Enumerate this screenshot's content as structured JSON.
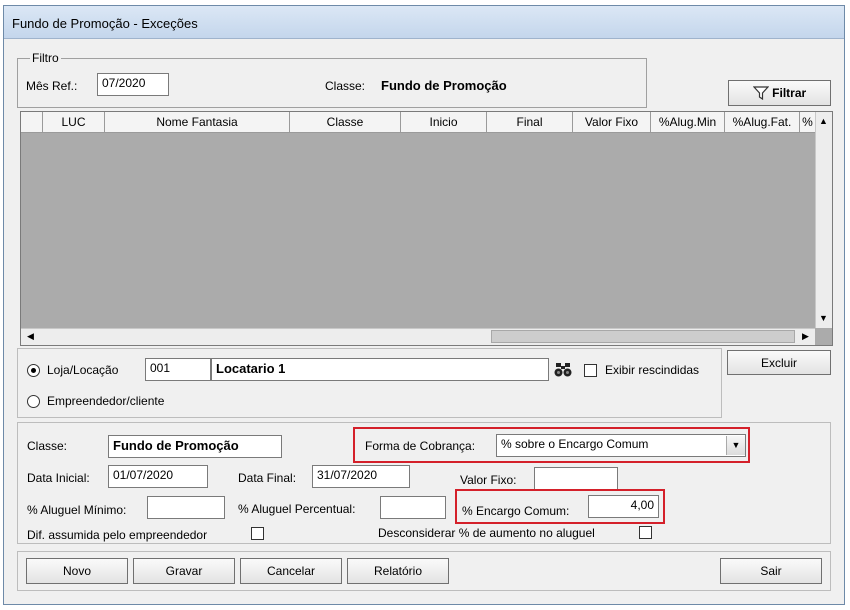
{
  "window": {
    "title": "Fundo de Promoção - Exceções"
  },
  "filter": {
    "legend": "Filtro",
    "mes_ref_label": "Mês Ref.:",
    "mes_ref_value": "07/2020",
    "classe_label": "Classe:",
    "classe_value": "Fundo de Promoção",
    "button_label": "Filtrar"
  },
  "grid": {
    "columns": [
      "LUC",
      "Nome Fantasia",
      "Classe",
      "Inicio",
      "Final",
      "Valor Fixo",
      "%Alug.Min",
      "%Alug.Fat.",
      "%"
    ]
  },
  "selection": {
    "radio_loja_label": "Loja/Locação",
    "loja_code": "001",
    "loja_name": "Locatario 1",
    "exibir_rescindidas_label": "Exibir rescindidas",
    "radio_empreendedor_label": "Empreendedor/cliente",
    "excluir_label": "Excluir"
  },
  "details": {
    "classe_label": "Classe:",
    "classe_value": "Fundo de Promoção",
    "forma_cobranca_label": "Forma de Cobrança:",
    "forma_cobranca_value": "% sobre o Encargo Comum",
    "data_inicial_label": "Data Inicial:",
    "data_inicial_value": "01/07/2020",
    "data_final_label": "Data Final:",
    "data_final_value": "31/07/2020",
    "valor_fixo_label": "Valor Fixo:",
    "valor_fixo_value": "",
    "aluguel_minimo_label": "% Aluguel Mínimo:",
    "aluguel_minimo_value": "",
    "aluguel_percentual_label": "% Aluguel Percentual:",
    "aluguel_percentual_value": "",
    "encargo_comum_label": "% Encargo Comum:",
    "encargo_comum_value": "4,00",
    "dif_assumida_label": "Dif. assumida pelo empreendedor",
    "desconsiderar_label": "Desconsiderar % de aumento no aluguel"
  },
  "footer": {
    "novo": "Novo",
    "gravar": "Gravar",
    "cancelar": "Cancelar",
    "relatorio": "Relatório",
    "sair": "Sair"
  }
}
